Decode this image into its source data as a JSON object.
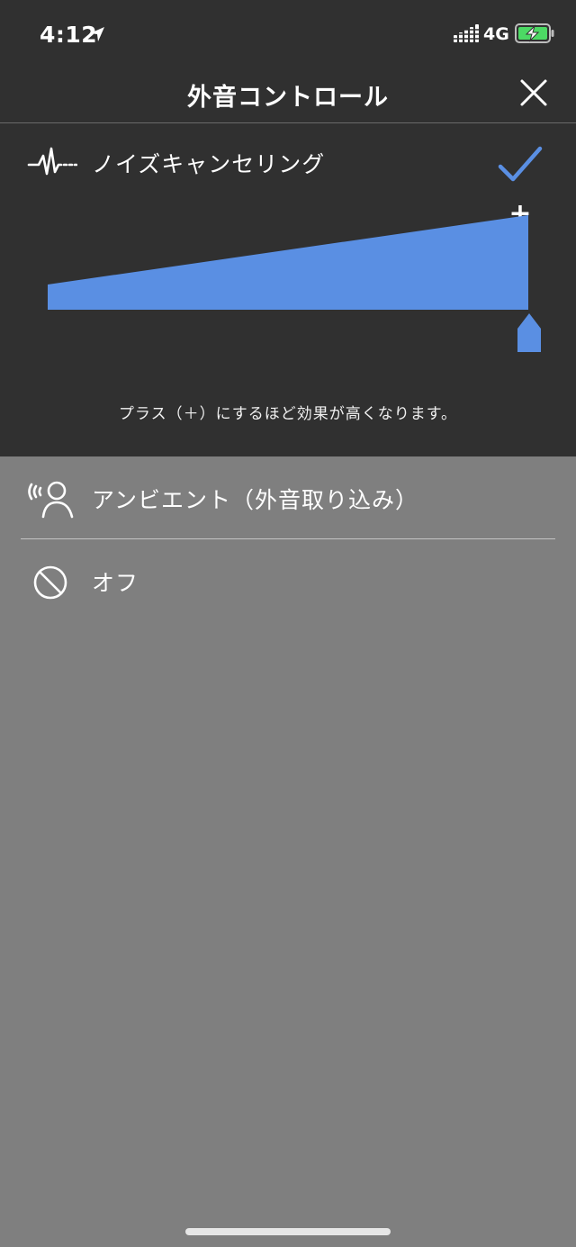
{
  "status_bar": {
    "time": "4:12",
    "network": "4G"
  },
  "header": {
    "title": "外音コントロール"
  },
  "modes": [
    {
      "label": "ノイズキャンセリング",
      "icon": "waveform-icon",
      "selected": true
    },
    {
      "label": "アンビエント（外音取り込み）",
      "icon": "ambient-listening-icon",
      "selected": false
    },
    {
      "label": "オフ",
      "icon": "off-icon",
      "selected": false
    }
  ],
  "noise_cancelling": {
    "level": 1.0,
    "plus_label": "+",
    "hint": "プラス（＋）にするほど効果が高くなります。"
  },
  "colors": {
    "accent": "#5a8fe3",
    "panel_background": "#303030",
    "page_background": "#7f7f7f",
    "battery_fill": "#4cd964"
  }
}
